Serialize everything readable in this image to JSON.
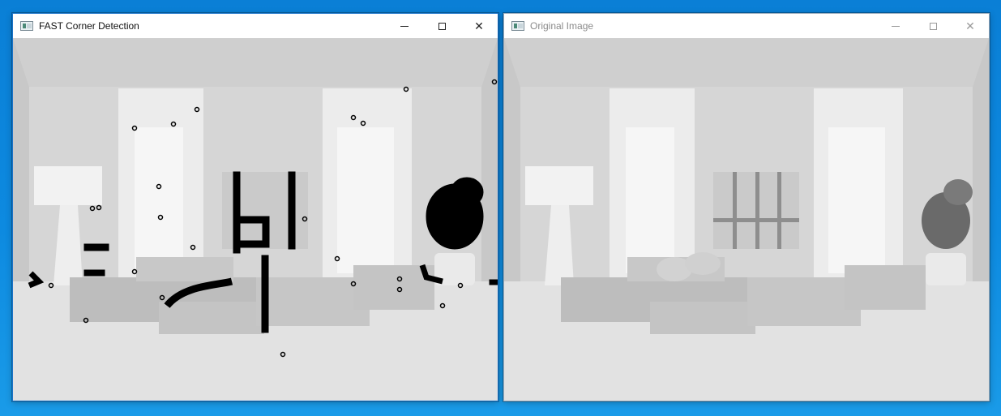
{
  "windows": {
    "left": {
      "title": "FAST Corner Detection",
      "icon": "app-window-icon",
      "controls": [
        "minimize-icon",
        "maximize-icon",
        "close-icon"
      ]
    },
    "right": {
      "title": "Original Image",
      "icon": "app-window-icon",
      "controls": [
        "minimize-icon",
        "maximize-icon",
        "close-icon"
      ]
    }
  },
  "colors": {
    "desktop": "#0d8ae0",
    "keypoint": "#000000",
    "active_border": "#1a73c9"
  }
}
